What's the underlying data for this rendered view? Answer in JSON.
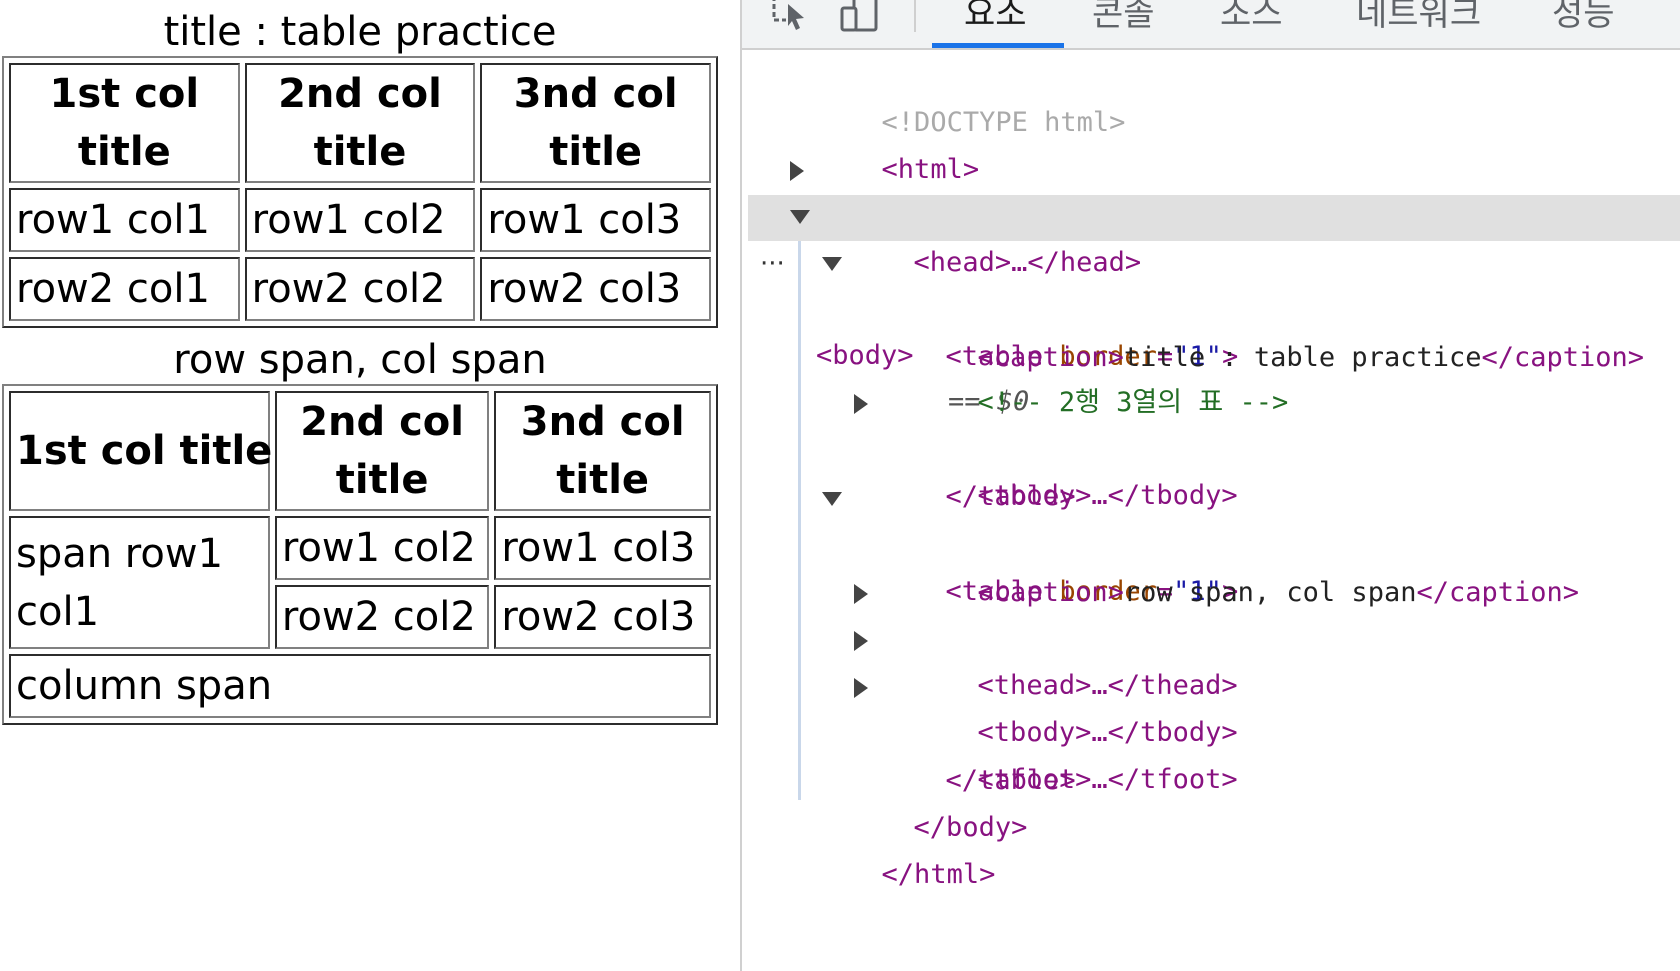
{
  "table1": {
    "caption": "title : table practice",
    "headers": [
      "1st col\ntitle",
      "2nd col\ntitle",
      "3nd col\ntitle"
    ],
    "header_lines": [
      [
        "1st col",
        "title"
      ],
      [
        "2nd col",
        "title"
      ],
      [
        "3nd col",
        "title"
      ]
    ],
    "rows": [
      [
        "row1 col1",
        "row1 col2",
        "row1 col3"
      ],
      [
        "row2 col1",
        "row2 col2",
        "row2 col3"
      ]
    ]
  },
  "table2": {
    "caption": "row span, col span",
    "header1": "1st col title",
    "header2_lines": [
      "2nd col",
      "title"
    ],
    "header3_lines": [
      "3nd col",
      "title"
    ],
    "span_cell_lines": [
      "span row1",
      "col1"
    ],
    "r1c2": "row1 col2",
    "r1c3": "row1 col3",
    "r2c2": "row2 col2",
    "r2c3": "row2 col3",
    "footer": "column span"
  },
  "devtools": {
    "tabs": [
      "요소",
      "콘솔",
      "소스",
      "네트워크",
      "성능"
    ],
    "active_tab": "요소",
    "accent": "#1a73e8",
    "icons": [
      "inspect-element-icon",
      "device-toolbar-icon"
    ],
    "dom": {
      "doctype": "<!DOCTYPE html>",
      "html_open": "<html>",
      "head": "<head>…</head>",
      "body_open": "<body>",
      "selected_marker": "== $0",
      "table_open_tag": "<table",
      "border_attr": "border",
      "border_val": "\"1\"",
      "caption1_open": "<caption>",
      "caption1_text": "title : table practice",
      "caption_close": "</caption>",
      "comment": "<!-- 2행 3열의 표 -->",
      "tbody": "<tbody>…</tbody>",
      "table_close": "</table>",
      "caption2_text": "row span, col span",
      "thead": "<thead>…</thead>",
      "tfoot": "<tfoot>…</tfoot>",
      "body_close": "</body>",
      "html_close": "</html>",
      "ellipsis": "···"
    }
  }
}
